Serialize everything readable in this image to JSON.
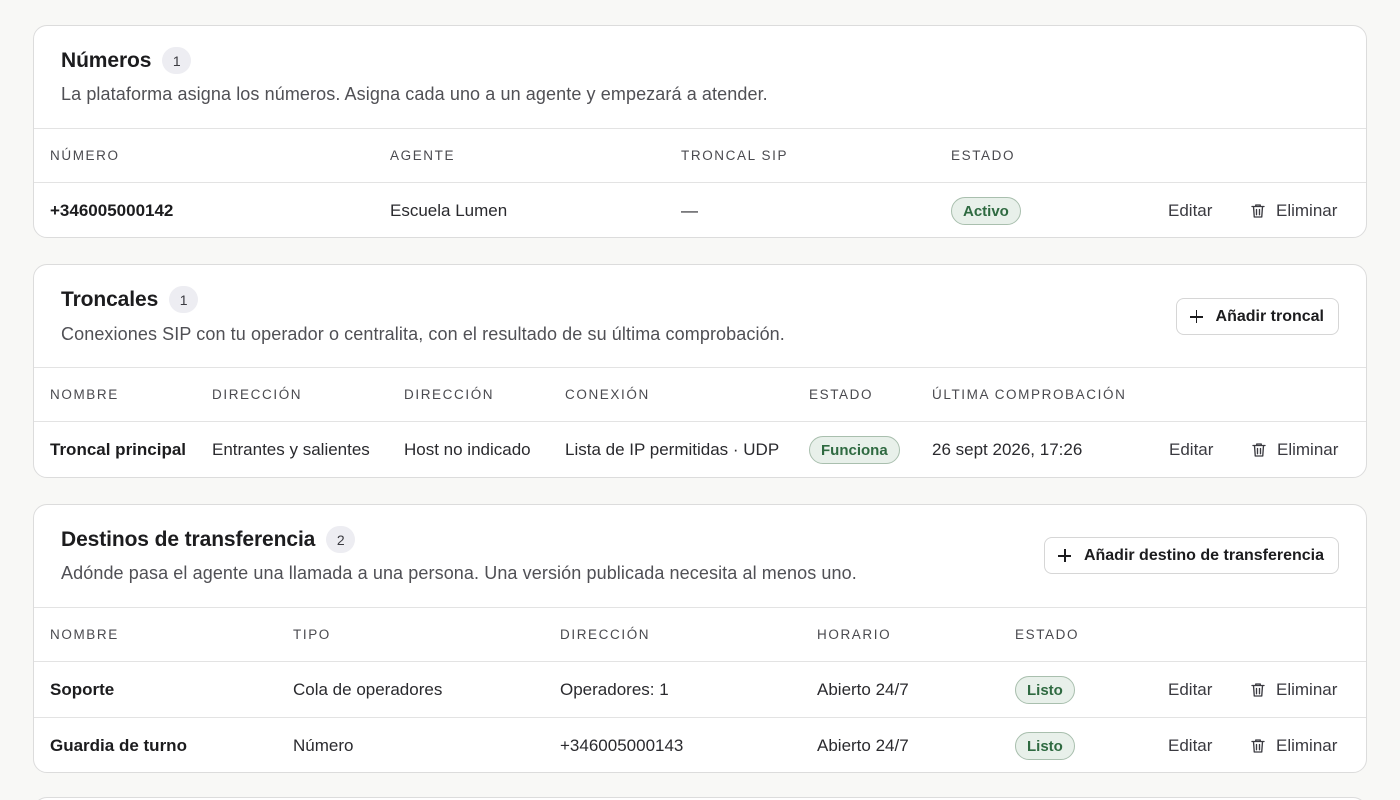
{
  "numeros": {
    "title": "Números",
    "count": "1",
    "description": "La plataforma asigna los números. Asigna cada uno a un agente y empezará a atender.",
    "columns": [
      "NÚMERO",
      "AGENTE",
      "TRONCAL SIP",
      "ESTADO"
    ],
    "rows": [
      {
        "numero": "+346005000142",
        "agente": "Escuela Lumen",
        "troncal": "—",
        "estado": "Activo",
        "edit": "Editar",
        "delete": "Eliminar"
      }
    ]
  },
  "troncales": {
    "title": "Troncales",
    "count": "1",
    "description": "Conexiones SIP con tu operador o centralita, con el resultado de su última comprobación.",
    "add_button": "Añadir troncal",
    "columns": [
      "NOMBRE",
      "DIRECCIÓN",
      "DIRECCIÓN",
      "CONEXIÓN",
      "ESTADO",
      "ÚLTIMA COMPROBACIÓN"
    ],
    "rows": [
      {
        "nombre": "Troncal principal",
        "direccion": "Entrantes y salientes",
        "direccion2": "Host no indicado",
        "conexion": "Lista de IP permitidas · UDP",
        "estado": "Funciona",
        "ultima": "26 sept 2026, 17:26",
        "edit": "Editar",
        "delete": "Eliminar"
      }
    ]
  },
  "destinos": {
    "title": "Destinos de transferencia",
    "count": "2",
    "description": "Adónde pasa el agente una llamada a una persona. Una versión publicada necesita al menos uno.",
    "add_button": "Añadir destino de transferencia",
    "columns": [
      "NOMBRE",
      "TIPO",
      "DIRECCIÓN",
      "HORARIO",
      "ESTADO"
    ],
    "rows": [
      {
        "nombre": "Soporte",
        "tipo": "Cola de operadores",
        "direccion": "Operadores: 1",
        "horario": "Abierto 24/7",
        "estado": "Listo",
        "edit": "Editar",
        "delete": "Eliminar"
      },
      {
        "nombre": "Guardia de turno",
        "tipo": "Número",
        "direccion": "+346005000143",
        "horario": "Abierto 24/7",
        "estado": "Listo",
        "edit": "Editar",
        "delete": "Eliminar"
      }
    ]
  },
  "icons": {
    "add": "plus-icon",
    "delete": "trash-icon"
  },
  "colors": {
    "status_bg": "#e8f0ea",
    "status_border": "#a9bfae",
    "status_text": "#2f6a41",
    "badge_bg": "#ededf2"
  }
}
